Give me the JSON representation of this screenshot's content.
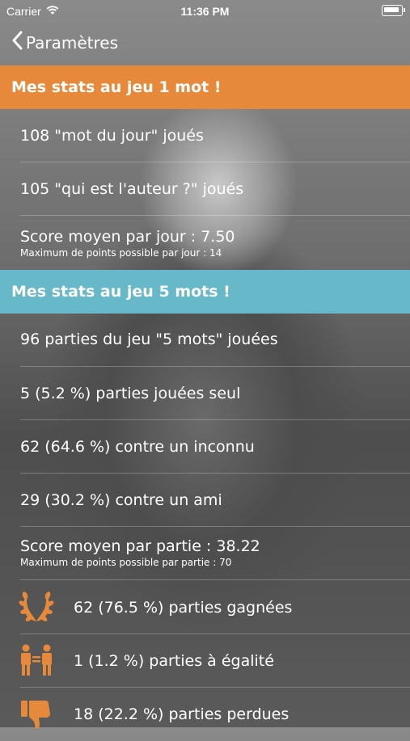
{
  "status": {
    "carrier": "Carrier",
    "time": "11:36 PM"
  },
  "nav": {
    "back_label": "Paramètres"
  },
  "section1": {
    "title": "Mes stats au jeu 1 mot !",
    "rows": [
      {
        "text": "108 \"mot du jour\" joués"
      },
      {
        "text": "105 \"qui est l'auteur ?\" joués"
      },
      {
        "text": "Score moyen par jour :  7.50",
        "sub": "Maximum de points possible par jour : 14"
      }
    ]
  },
  "section2": {
    "title": "Mes stats au jeu 5 mots !",
    "rows": [
      {
        "text": "96 parties du jeu \"5 mots\" jouées"
      },
      {
        "text": "5 (5.2 %) parties jouées seul"
      },
      {
        "text": "62 (64.6 %) contre un inconnu"
      },
      {
        "text": "29 (30.2 %) contre un ami"
      },
      {
        "text": "Score moyen par partie :  38.22",
        "sub": "Maximum de points possible par partie : 70"
      }
    ],
    "icon_rows": [
      {
        "icon": "laurel-wreath-icon",
        "text": "62 (76.5 %) parties gagnées"
      },
      {
        "icon": "equality-people-icon",
        "text": "1 (1.2 %) parties à égalité"
      },
      {
        "icon": "thumbs-down-icon",
        "text": "18 (22.2 %) parties perdues"
      }
    ]
  },
  "colors": {
    "orange": "#e6893a",
    "blue": "#67b9c9"
  }
}
